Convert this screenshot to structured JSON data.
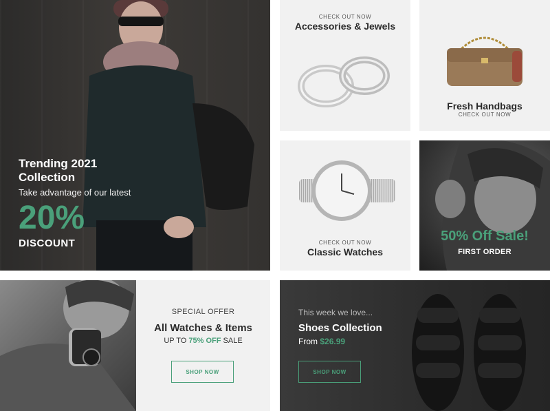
{
  "accent_color": "#4aa07a",
  "trending": {
    "title": "Trending 2021 Collection",
    "subtitle": "Take advantage of our latest",
    "percent": "20%",
    "discount": "DISCOUNT"
  },
  "accessories": {
    "kicker": "CHECK OUT NOW",
    "title": "Accessories & Jewels"
  },
  "handbags": {
    "title": "Fresh Handbags",
    "kicker": "CHECK OUT NOW"
  },
  "watches": {
    "kicker": "CHECK OUT NOW",
    "title": "Classic Watches"
  },
  "sale": {
    "headline": "50% Off Sale!",
    "sub": "FIRST ORDER"
  },
  "special": {
    "kicker": "SPECIAL OFFER",
    "title": "All Watches & Items",
    "upto_prefix": "UP TO",
    "upto_value": "75% OFF",
    "upto_suffix": "SALE",
    "button": "SHOP NOW"
  },
  "shoes": {
    "kicker": "This week we love...",
    "title": "Shoes Collection",
    "from_prefix": "From",
    "price": "$26.99",
    "button": "SHOP NOW"
  },
  "icons": [
    "rings-image",
    "handbag-image",
    "watch-image",
    "sandals-image"
  ]
}
